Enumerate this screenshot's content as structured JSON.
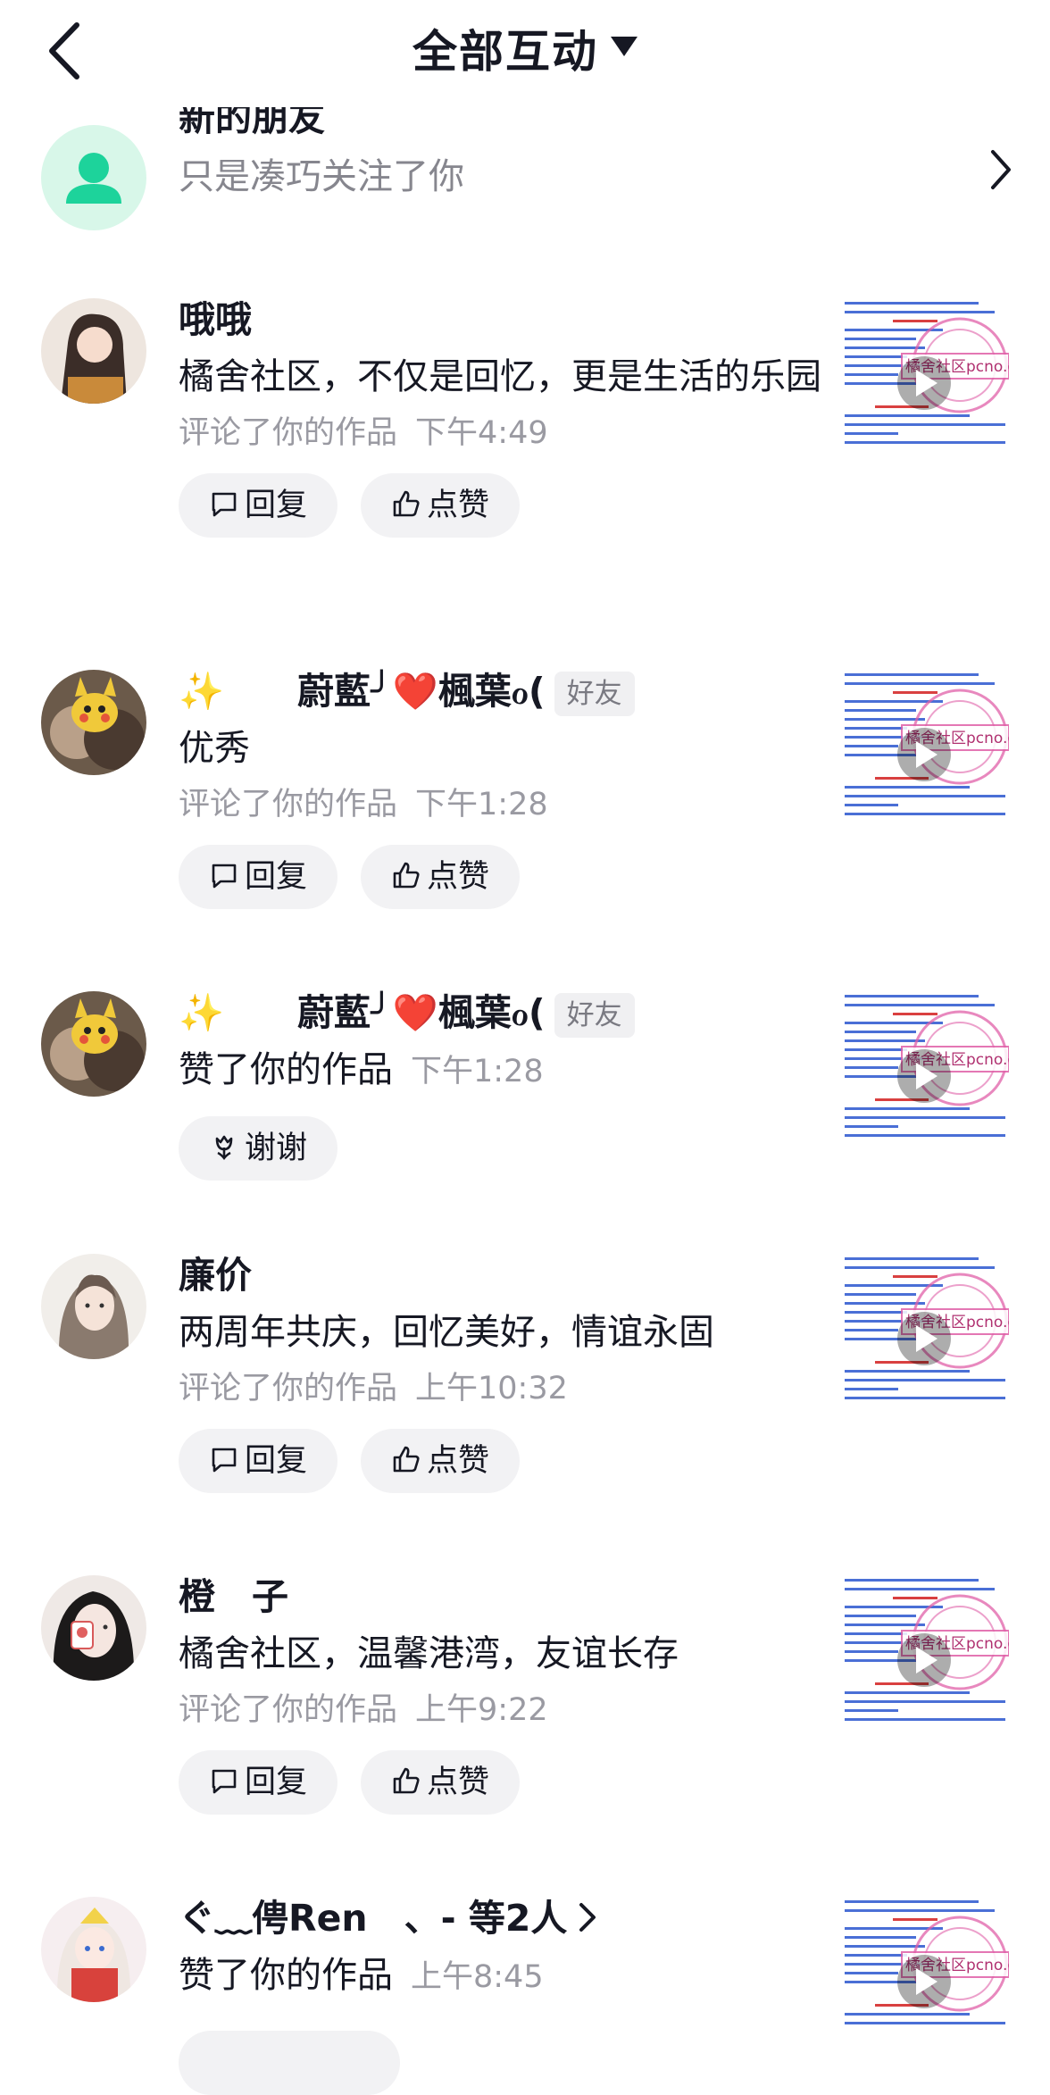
{
  "header": {
    "title": "全部互动"
  },
  "new_friend": {
    "title": "新的朋友",
    "subtitle": "只是凑巧关注了你"
  },
  "actions": {
    "reply": "回复",
    "like": "点赞",
    "thanks": "谢谢"
  },
  "items": [
    {
      "name": "哦哦",
      "comment": "橘舍社区，不仅是回忆，更是生活的乐园",
      "action": "评论了你的作品",
      "time": "下午4:49"
    },
    {
      "name": "✨　　蔚藍╯❤️楓葉ℴ(",
      "badge": "好友",
      "comment": "优秀",
      "action": "评论了你的作品",
      "time": "下午1:28"
    },
    {
      "name": "✨　　蔚藍╯❤️楓葉ℴ(",
      "badge": "好友",
      "action": "赞了你的作品",
      "time": "下午1:28"
    },
    {
      "name": "廉价",
      "comment": "两周年共庆，回忆美好，情谊永固",
      "action": "评论了你的作品",
      "time": "上午10:32"
    },
    {
      "name": "橙　子",
      "comment": "橘舍社区，温馨港湾，友谊长存",
      "action": "评论了你的作品",
      "time": "上午9:22"
    },
    {
      "name": "ぐ﹏俜Ren　、- 等2人",
      "action": "赞了你的作品",
      "time": "上午8:45"
    }
  ],
  "thumbnail": {
    "watermark": "橘舍社区pcno.cn"
  }
}
